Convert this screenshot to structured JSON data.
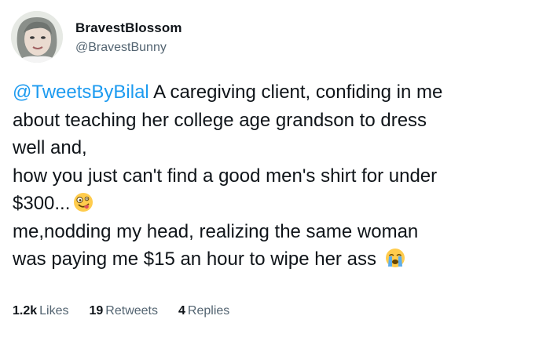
{
  "author": {
    "display_name": "BravestBlossom",
    "handle": "@BravestBunny",
    "avatar": "avatar-photo"
  },
  "tweet": {
    "mention": "@TweetsByBilal",
    "lines": [
      " A caregiving client, confiding in me",
      "about teaching her college age grandson to dress",
      "well and,",
      "how you just can't find a good men's shirt for under",
      "$300...",
      "me,nodding my head, realizing the same woman",
      "was paying me $15 an hour to wipe her ass"
    ],
    "emojis": [
      "zany-face-icon",
      "loudly-crying-face-icon"
    ]
  },
  "stats": {
    "likes_count": "1.2k",
    "likes_label": "Likes",
    "retweets_count": "19",
    "retweets_label": "Retweets",
    "replies_count": "4",
    "replies_label": "Replies"
  },
  "colors": {
    "link": "#1d9bf0",
    "text": "#0f1419",
    "muted": "#536471",
    "emoji_yellow": "#ffcc4d",
    "emoji_tear": "#5dadec"
  }
}
